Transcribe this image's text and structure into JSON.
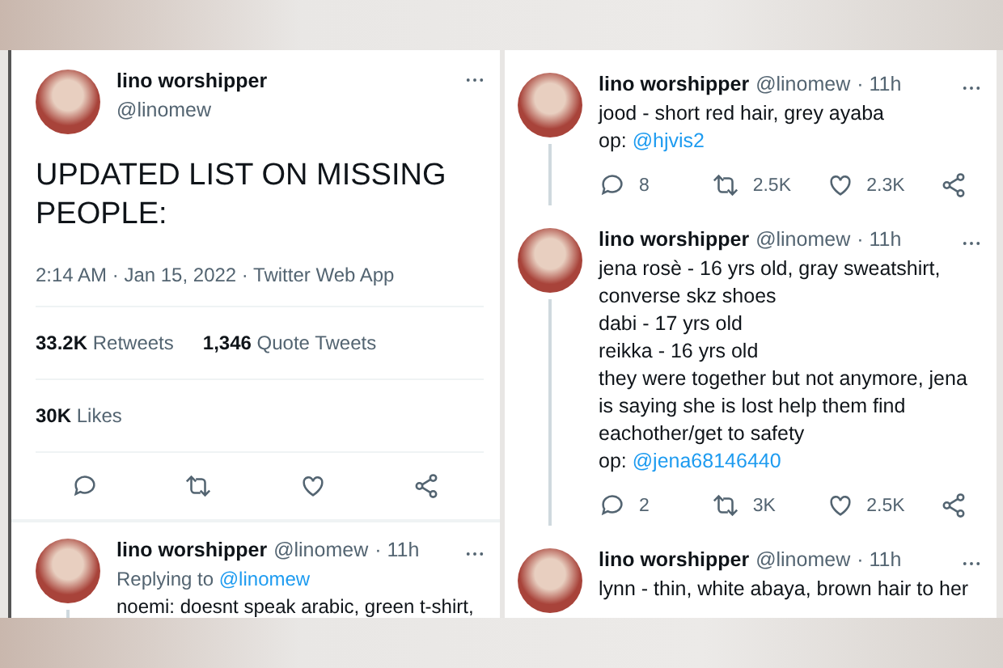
{
  "main_tweet": {
    "name": "lino worshipper",
    "handle": "@linomew",
    "text": "UPDATED LIST ON MISSING PEOPLE:",
    "meta": "2:14 AM · Jan 15, 2022 · Twitter Web App",
    "stats": [
      "**33.2K** Retweets",
      "**1,346** Quote Tweets"
    ],
    "likes": "**30K** Likes"
  },
  "left_replies": [
    {
      "name": "lino worshipper",
      "handle": "@linomew",
      "time": "· 11h",
      "replying_to": {
        "prefix": "Replying to",
        "mention": "@linomew"
      },
      "lines": [
        "noemi: doesnt speak arabic, green t-shirt,"
      ]
    }
  ],
  "right_replies": [
    {
      "name": "lino worshipper",
      "handle": "@linomew",
      "time": "· 11h",
      "lines": [
        "jood - short red hair, grey ayaba"
      ],
      "op": {
        "prefix": "op:",
        "mention": "@hjvis2"
      },
      "counts": {
        "replies": "8",
        "retweets": "2.5K",
        "likes": "2.3K"
      }
    },
    {
      "name": "lino worshipper",
      "handle": "@linomew",
      "time": "· 11h",
      "lines": [
        "jena rosè - 16 yrs old, gray sweatshirt, converse skz shoes",
        "dabi - 17 yrs old",
        "reikka - 16 yrs old",
        "they were together but not anymore, jena is saying she is lost help them find eachother/get to safety"
      ],
      "op": {
        "prefix": "op:",
        "mention": "@jena68146440"
      },
      "counts": {
        "replies": "2",
        "retweets": "3K",
        "likes": "2.5K"
      }
    },
    {
      "name": "lino worshipper",
      "handle": "@linomew",
      "time": "· 11h",
      "lines": [
        "lynn - thin, white abaya, brown hair to her"
      ]
    }
  ]
}
